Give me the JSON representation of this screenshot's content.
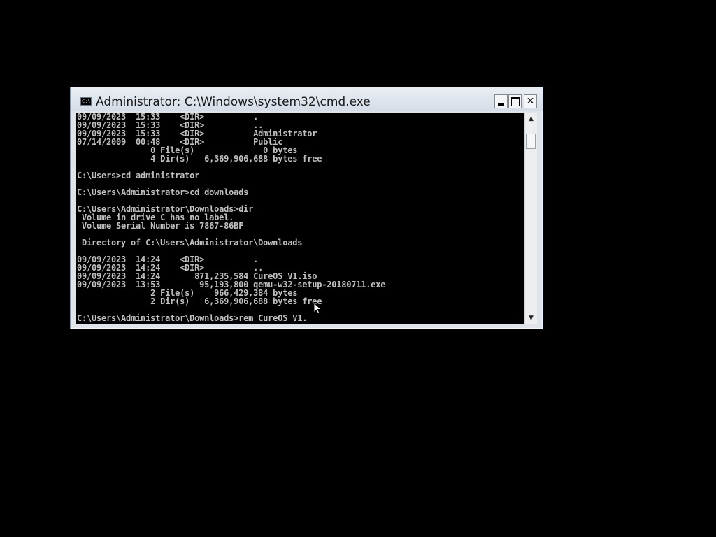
{
  "window": {
    "title": "Administrator: C:\\Windows\\system32\\cmd.exe",
    "icon": "cmd-icon",
    "icon_text": "C:\\",
    "buttons": {
      "minimize": "minimize-icon",
      "maximize": "maximize-icon",
      "close_label": "✕"
    }
  },
  "console": {
    "lines": [
      "09/09/2023  15:33    <DIR>          .",
      "09/09/2023  15:33    <DIR>          ..",
      "09/09/2023  15:33    <DIR>          Administrator",
      "07/14/2009  00:48    <DIR>          Public",
      "               0 File(s)              0 bytes",
      "               4 Dir(s)   6,369,906,688 bytes free",
      "",
      "C:\\Users>cd administrator",
      "",
      "C:\\Users\\Administrator>cd downloads",
      "",
      "C:\\Users\\Administrator\\Downloads>dir",
      " Volume in drive C has no label.",
      " Volume Serial Number is 7867-86BF",
      "",
      " Directory of C:\\Users\\Administrator\\Downloads",
      "",
      "09/09/2023  14:24    <DIR>          .",
      "09/09/2023  14:24    <DIR>          ..",
      "09/09/2023  14:24       871,235,584 CureOS V1.iso",
      "09/09/2023  13:53        95,193,800 qemu-w32-setup-20180711.exe",
      "               2 File(s)    966,429,384 bytes",
      "               2 Dir(s)   6,369,906,688 bytes free",
      "",
      "C:\\Users\\Administrator\\Downloads>rem CureOS V1."
    ]
  },
  "scrollbar": {
    "up_arrow": "▲",
    "down_arrow": "▼"
  },
  "colors": {
    "console_bg": "#000000",
    "console_fg": "#c0c0c0",
    "titlebar": "#dfe4ea"
  }
}
